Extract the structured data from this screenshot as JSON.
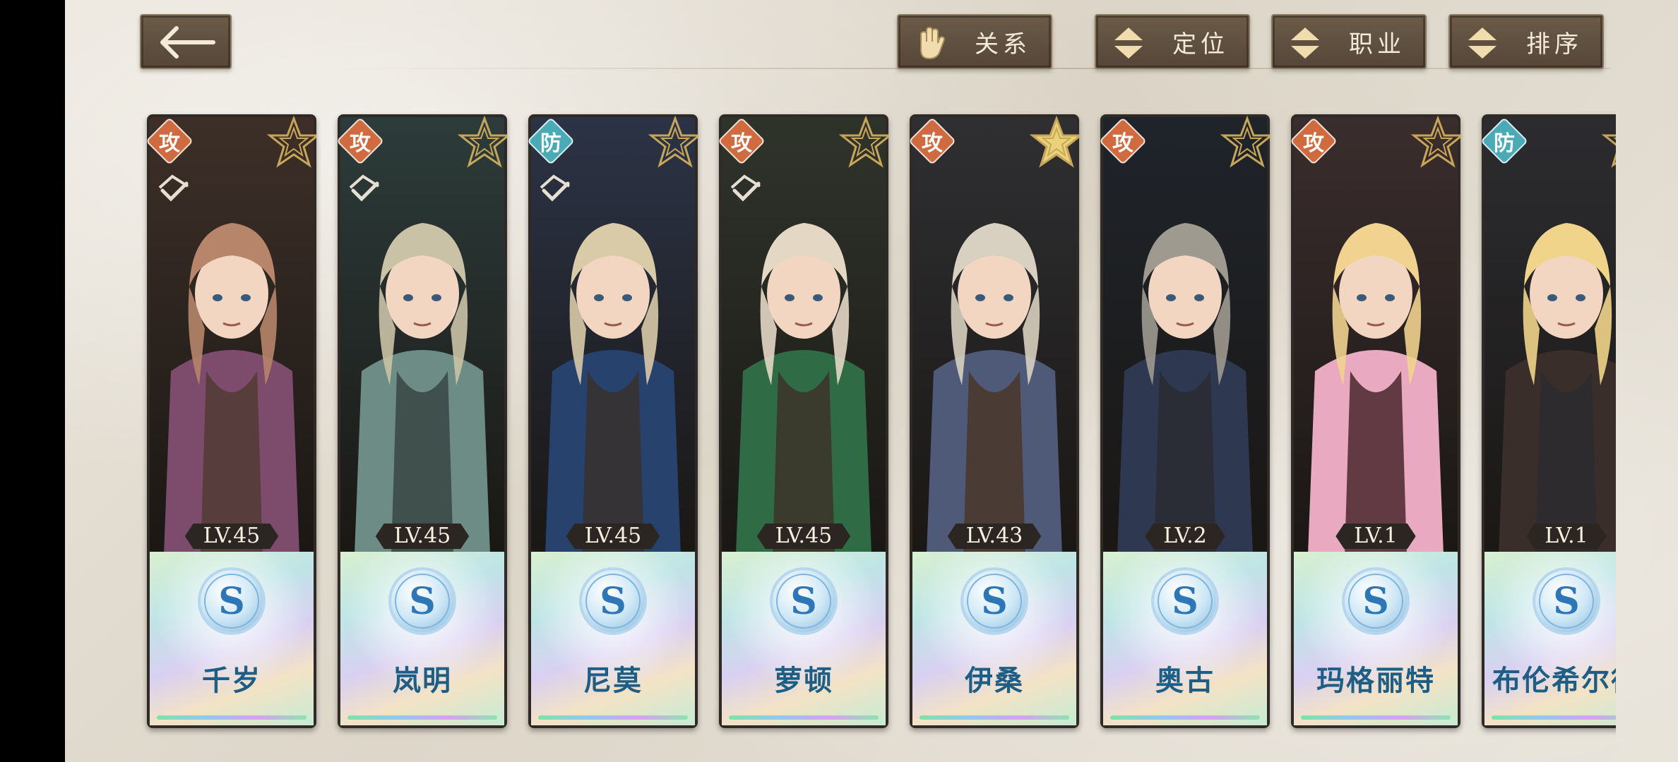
{
  "header": {
    "back_icon": "back-arrow-icon",
    "buttons": [
      {
        "label": "关系",
        "icon": "gloved-hand-icon"
      },
      {
        "label": "定位",
        "icon": "sort-arrows-icon"
      },
      {
        "label": "职业",
        "icon": "sort-arrows-icon"
      },
      {
        "label": "排序",
        "icon": "sort-arrows-icon"
      }
    ]
  },
  "colors": {
    "button_bg": "#5f5040",
    "attack_badge": "#d06a3f",
    "defense_badge": "#4aaab6",
    "name_text": "#1f5e84"
  },
  "characters": [
    {
      "name": "千岁",
      "role": "攻",
      "level": "LV.45",
      "rank": "S",
      "star": "outline",
      "selected": true
    },
    {
      "name": "岚明",
      "role": "攻",
      "level": "LV.45",
      "rank": "S",
      "star": "outline",
      "selected": true
    },
    {
      "name": "尼莫",
      "role": "防",
      "level": "LV.45",
      "rank": "S",
      "star": "outline",
      "selected": true
    },
    {
      "name": "萝顿",
      "role": "攻",
      "level": "LV.45",
      "rank": "S",
      "star": "outline",
      "selected": true
    },
    {
      "name": "伊桑",
      "role": "攻",
      "level": "LV.43",
      "rank": "S",
      "star": "filled",
      "selected": false
    },
    {
      "name": "奥古",
      "role": "攻",
      "level": "LV.2",
      "rank": "S",
      "star": "outline",
      "selected": false
    },
    {
      "name": "玛格丽特",
      "role": "攻",
      "level": "LV.1",
      "rank": "S",
      "star": "outline",
      "selected": false
    },
    {
      "name": "布伦希尔德",
      "role": "防",
      "level": "LV.1",
      "rank": "S",
      "star": "outline",
      "selected": false
    }
  ]
}
